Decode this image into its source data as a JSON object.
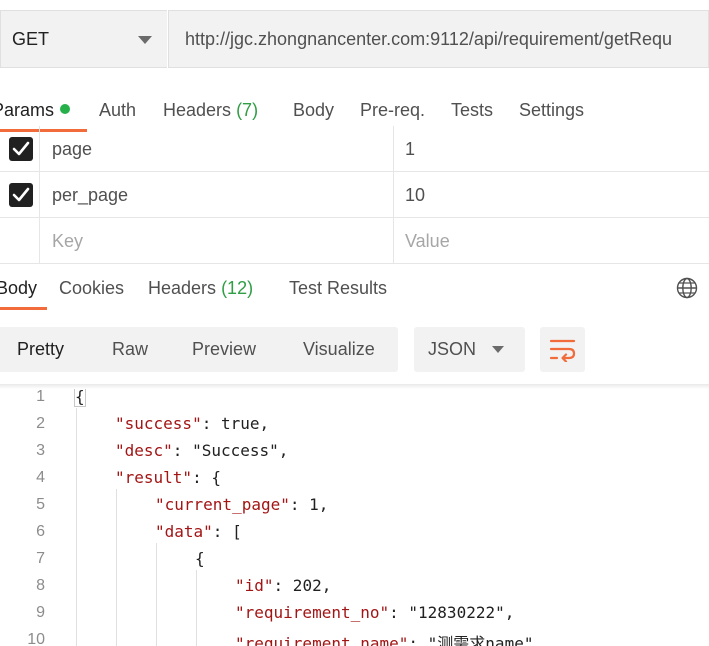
{
  "request": {
    "method": "GET",
    "url": "http://jgc.zhongnancenter.com:9112/api/requirement/getRequ"
  },
  "request_tabs": [
    {
      "label": "Params",
      "active": true,
      "indicator": true
    },
    {
      "label": "Auth"
    },
    {
      "label": "Headers",
      "count": "(7)"
    },
    {
      "label": "Body"
    },
    {
      "label": "Pre-req."
    },
    {
      "label": "Tests"
    },
    {
      "label": "Settings"
    }
  ],
  "params": [
    {
      "checked": true,
      "key": "page",
      "value": "1"
    },
    {
      "checked": true,
      "key": "per_page",
      "value": "10"
    }
  ],
  "params_placeholder": {
    "key": "Key",
    "value": "Value"
  },
  "response_tabs": [
    {
      "label": "Body",
      "active": true
    },
    {
      "label": "Cookies"
    },
    {
      "label": "Headers",
      "count": "(12)"
    },
    {
      "label": "Test Results"
    }
  ],
  "view_modes": [
    "Pretty",
    "Raw",
    "Preview",
    "Visualize"
  ],
  "active_view": "Pretty",
  "format": "JSON",
  "icons": {
    "globe": "globe-icon",
    "wrap": "wrap-lines-icon",
    "check": "check-icon"
  },
  "colors": {
    "accent": "#f26b3a",
    "indicator": "#26b04a",
    "count": "#2f9e44"
  },
  "code_lines": [
    {
      "num": "1",
      "text": "{"
    },
    {
      "num": "2",
      "text": "\"success\": true,"
    },
    {
      "num": "3",
      "text": "\"desc\": \"Success\","
    },
    {
      "num": "4",
      "text": "\"result\": {"
    },
    {
      "num": "5",
      "text": "\"current_page\": 1,"
    },
    {
      "num": "6",
      "text": "\"data\": ["
    },
    {
      "num": "7",
      "text": "{"
    },
    {
      "num": "8",
      "text": "\"id\": 202,"
    },
    {
      "num": "9",
      "text": "\"requirement_no\": \"12830222\","
    },
    {
      "num": "10",
      "text": "\"requirement_name\": \"测需求name\","
    }
  ]
}
